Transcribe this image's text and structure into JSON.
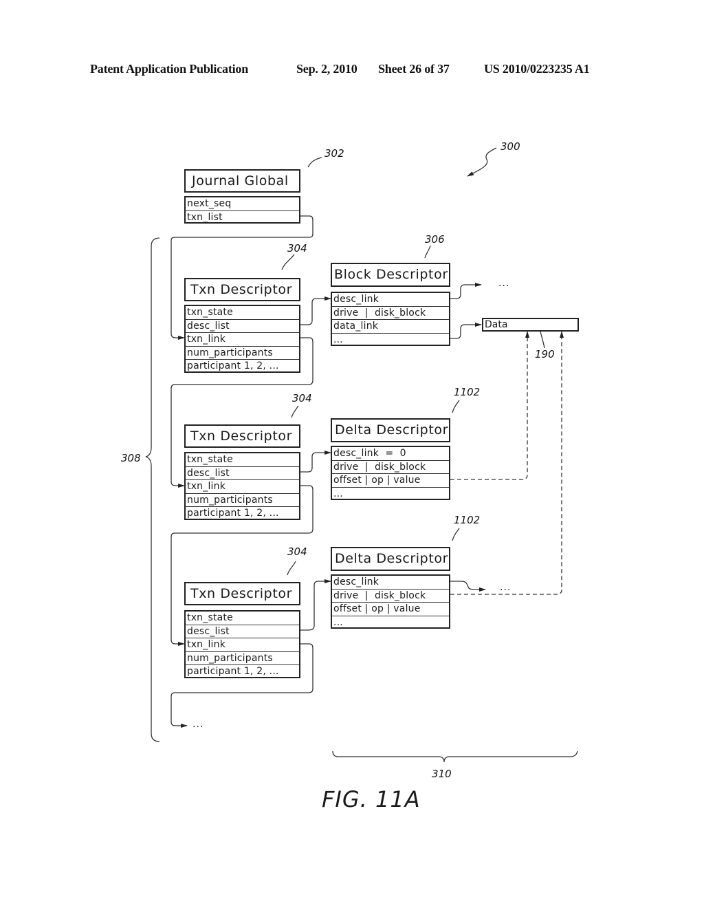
{
  "header": {
    "publication": "Patent Application Publication",
    "date": "Sep. 2, 2010",
    "sheet": "Sheet 26 of 37",
    "number": "US 2010/0223235 A1"
  },
  "figure_label": "FIG. 11A",
  "refs": {
    "r300": "300",
    "r302": "302",
    "r304a": "304",
    "r304b": "304",
    "r304c": "304",
    "r306": "306",
    "r1102a": "1102",
    "r1102b": "1102",
    "r190": "190",
    "r308": "308",
    "r310": "310"
  },
  "journal_global": {
    "title": "Journal Global",
    "fields": [
      "next_seq",
      "txn_list"
    ]
  },
  "txn_descriptors": [
    {
      "title": "Txn Descriptor",
      "fields": [
        "txn_state",
        "desc_list",
        "txn_link",
        "num_participants",
        "participant 1, 2, ..."
      ]
    },
    {
      "title": "Txn Descriptor",
      "fields": [
        "txn_state",
        "desc_list",
        "txn_link",
        "num_participants",
        "participant 1, 2, ..."
      ]
    },
    {
      "title": "Txn Descriptor",
      "fields": [
        "txn_state",
        "desc_list",
        "txn_link",
        "num_participants",
        "participant 1, 2, ..."
      ]
    }
  ],
  "block_descriptor": {
    "title": "Block Descriptor",
    "fields": [
      "desc_link",
      "drive  |  disk_block",
      "data_link",
      "..."
    ]
  },
  "delta_descriptors": [
    {
      "title": "Delta Descriptor",
      "fields": [
        "desc_link  =  0",
        "drive  |  disk_block",
        "offset | op | value",
        "..."
      ]
    },
    {
      "title": "Delta Descriptor",
      "fields": [
        "desc_link",
        "drive  |  disk_block",
        "offset | op | value",
        "..."
      ]
    }
  ],
  "data_block": {
    "label": "Data"
  },
  "ellipsis": "..."
}
